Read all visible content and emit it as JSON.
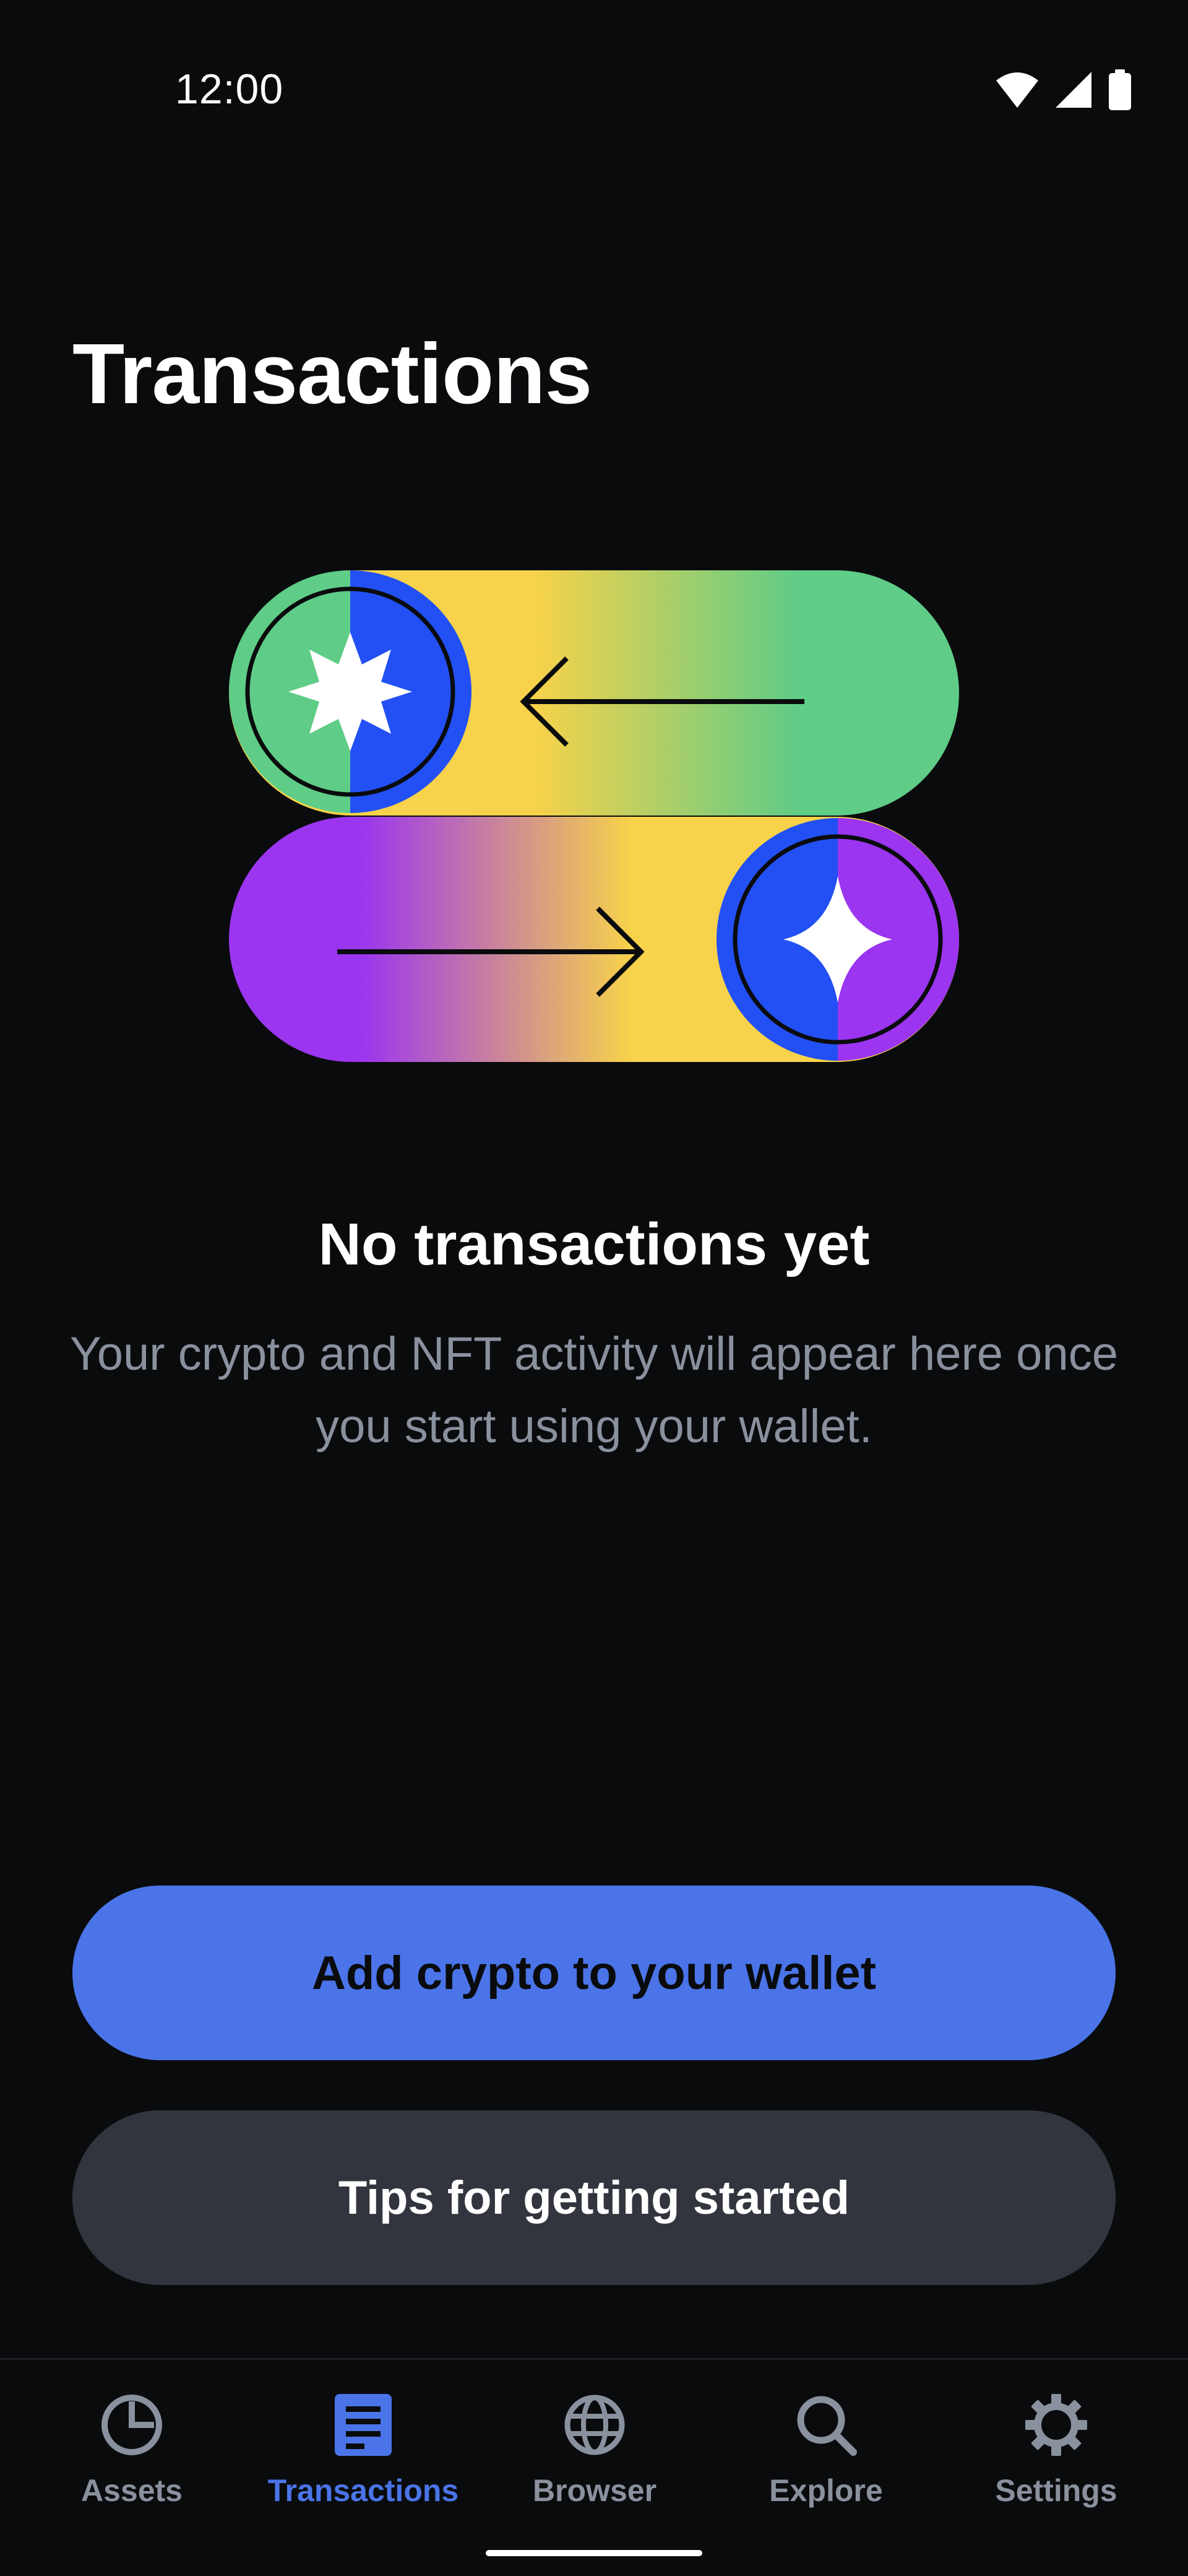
{
  "status_bar": {
    "time": "12:00",
    "icons": [
      "wifi-icon",
      "cellular-signal-icon",
      "battery-icon"
    ]
  },
  "page": {
    "title": "Transactions"
  },
  "illustration": {
    "name": "swap-illustration",
    "colors": {
      "yellow": "#f7d24a",
      "green": "#5fcc87",
      "purple": "#9b35f0",
      "blue": "#2250f4",
      "white": "#ffffff",
      "outline": "#0a0b0d"
    }
  },
  "empty_state": {
    "title": "No transactions yet",
    "description": "Your crypto and NFT activity will appear here once you start using your wallet."
  },
  "buttons": {
    "primary_label": "Add crypto to your wallet",
    "secondary_label": "Tips for getting started"
  },
  "bottom_nav": {
    "active": "Transactions",
    "items": [
      {
        "label": "Assets",
        "icon": "pie-chart-icon"
      },
      {
        "label": "Transactions",
        "icon": "document-list-icon"
      },
      {
        "label": "Browser",
        "icon": "globe-icon"
      },
      {
        "label": "Explore",
        "icon": "search-icon"
      },
      {
        "label": "Settings",
        "icon": "gear-icon"
      }
    ]
  },
  "theme": {
    "background": "#0a0b0d",
    "accent": "#4a74e8",
    "secondary_button": "#32353d",
    "muted_text": "#8a919e"
  }
}
